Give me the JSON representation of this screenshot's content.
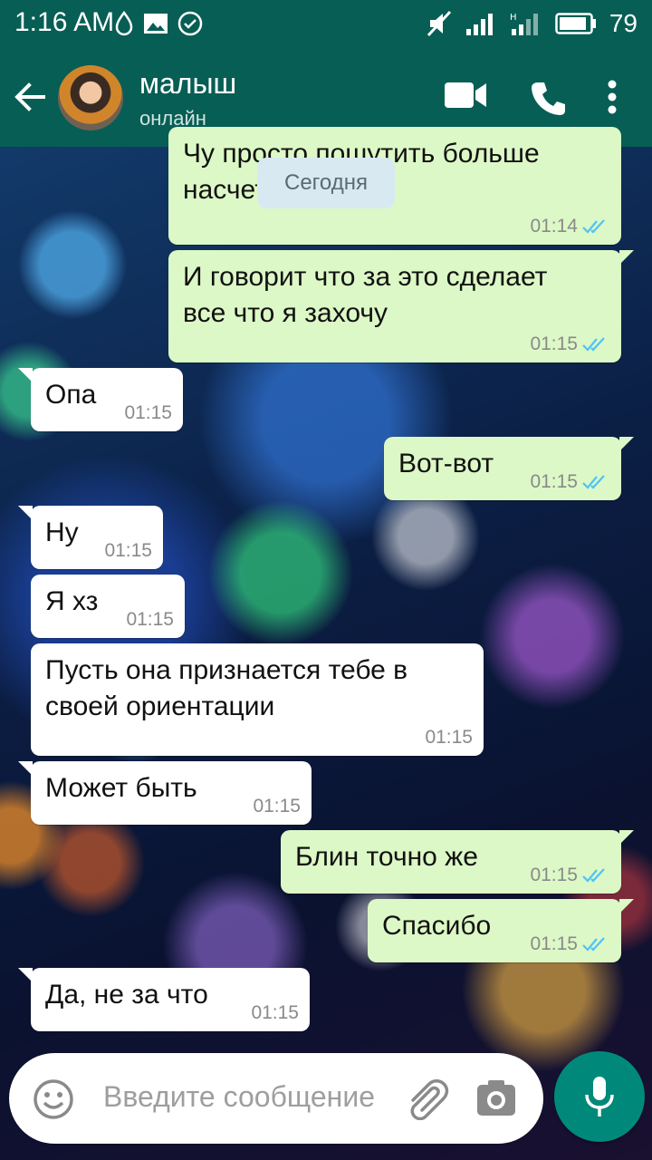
{
  "status_bar": {
    "time": "1:16 AM",
    "battery": "79"
  },
  "header": {
    "contact_name": "малыш",
    "contact_status": "онлайн"
  },
  "date_chip": "Сегодня",
  "messages": [
    {
      "dir": "out",
      "text": "Чу просто пошутить больше\nнасчет",
      "time": "01:14",
      "read": true
    },
    {
      "dir": "out",
      "text": "И говорит что за это сделает\nвсе что я захочу",
      "time": "01:15",
      "read": true
    },
    {
      "dir": "in",
      "text": "Опа",
      "time": "01:15"
    },
    {
      "dir": "out",
      "text": "Вот-вот",
      "time": "01:15",
      "read": true
    },
    {
      "dir": "in",
      "text": "Ну",
      "time": "01:15"
    },
    {
      "dir": "in",
      "text": "Я хз",
      "time": "01:15"
    },
    {
      "dir": "in",
      "text": "Пусть она признается тебе в\nсвоей ориентации",
      "time": "01:15"
    },
    {
      "dir": "in",
      "text": "Может быть",
      "time": "01:15"
    },
    {
      "dir": "out",
      "text": "Блин точно же",
      "time": "01:15",
      "read": true
    },
    {
      "dir": "out",
      "text": "Спасибо",
      "time": "01:15",
      "read": true
    },
    {
      "dir": "in",
      "text": "Да, не за что",
      "time": "01:15"
    }
  ],
  "input": {
    "placeholder": "Введите сообщение"
  },
  "colors": {
    "header": "#075e54",
    "outgoing_bubble": "#dcf8c6",
    "incoming_bubble": "#ffffff",
    "mic_button": "#00897b",
    "read_ticks": "#4fc3f7"
  },
  "icons": [
    "back-arrow-icon",
    "video-call-icon",
    "phone-icon",
    "more-vert-icon",
    "emoji-icon",
    "attach-icon",
    "camera-icon",
    "mic-icon"
  ]
}
